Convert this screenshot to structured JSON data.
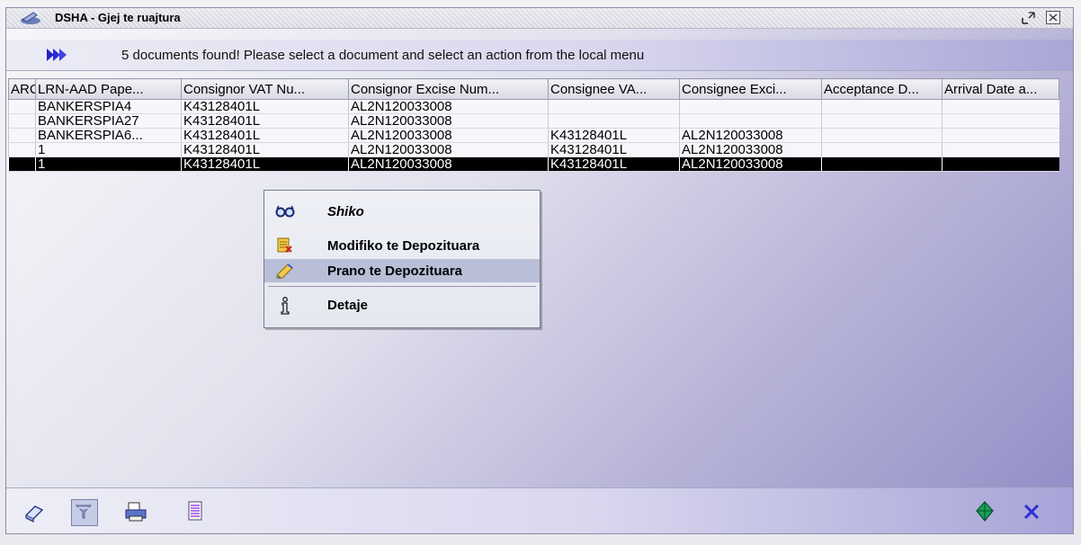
{
  "window": {
    "title": "DSHA - Gjej te ruajtura"
  },
  "message": "5 documents found! Please select a document and select an action from the local menu",
  "grid": {
    "columns": [
      "ARC",
      "LRN-AAD Pape...",
      "Consignor VAT Nu...",
      "Consignor Excise Num...",
      "Consignee VA...",
      "Consignee Exci...",
      "Acceptance D...",
      "Arrival Date a..."
    ],
    "rows": [
      [
        "",
        "BANKERSPIA4",
        "K43128401L",
        "AL2N120033008",
        "",
        "",
        "",
        ""
      ],
      [
        "",
        "BANKERSPIA27",
        "K43128401L",
        "AL2N120033008",
        "",
        "",
        "",
        ""
      ],
      [
        "",
        "BANKERSPIA6...",
        "K43128401L",
        "AL2N120033008",
        "K43128401L",
        "AL2N120033008",
        "",
        ""
      ],
      [
        "",
        "1",
        "K43128401L",
        "AL2N120033008",
        "K43128401L",
        "AL2N120033008",
        "",
        ""
      ],
      [
        "",
        "1",
        "K43128401L",
        "AL2N120033008",
        "K43128401L",
        "AL2N120033008",
        "",
        ""
      ]
    ],
    "selected_row": 4
  },
  "context_menu": {
    "items": [
      {
        "label": "Shiko",
        "icon": "glasses-icon"
      },
      {
        "label": "Modifiko te Depozituara",
        "icon": "edit-document-icon"
      },
      {
        "label": "Prano te Depozituara",
        "icon": "accept-pencil-icon"
      },
      {
        "label": "Detaje",
        "icon": "info-icon"
      }
    ],
    "hovered_index": 2
  },
  "toolbar": {
    "left_icons": [
      "book-icon",
      "filter-icon",
      "print-icon",
      "export-icon"
    ],
    "right_icons": [
      "confirm-gem-icon",
      "close-x-icon"
    ]
  },
  "colors": {
    "selected_row_bg": "#000000",
    "menu_hover_bg": "#b8bfd6",
    "accent_blue": "#2f2fd6"
  }
}
